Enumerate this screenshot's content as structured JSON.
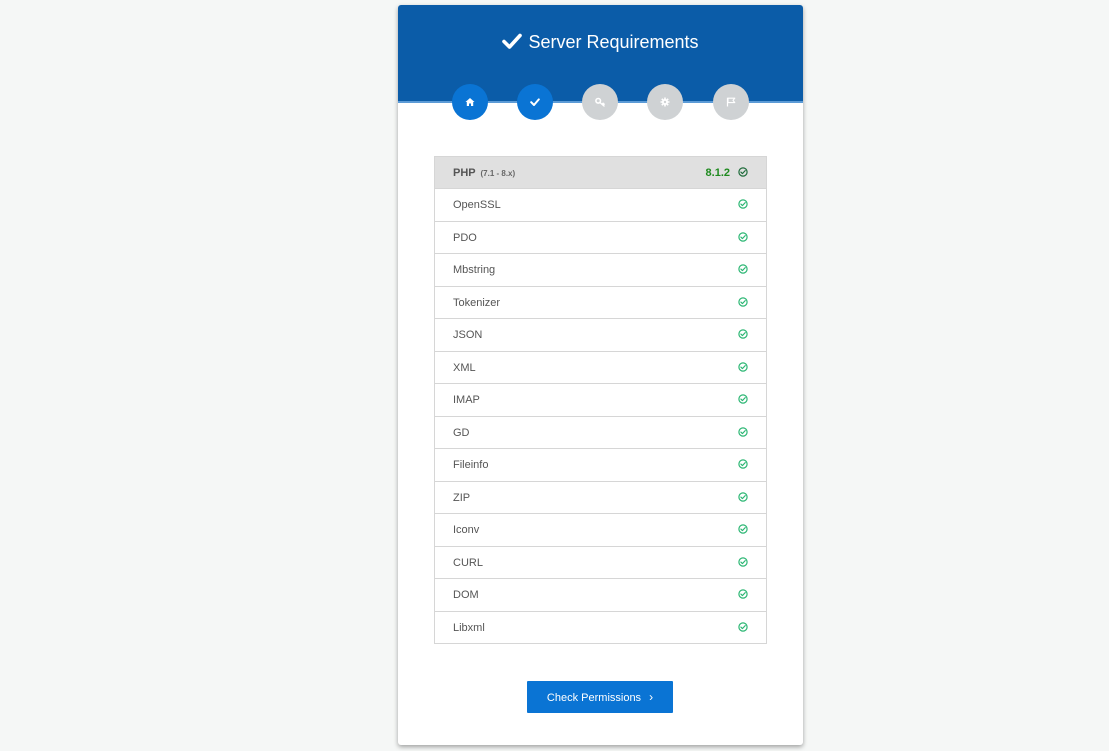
{
  "header": {
    "title": "Server Requirements",
    "icon": "check-icon"
  },
  "steps": [
    {
      "icon": "home-icon",
      "active": true
    },
    {
      "icon": "check-icon",
      "active": true
    },
    {
      "icon": "key-icon",
      "active": false
    },
    {
      "icon": "gear-icon",
      "active": false
    },
    {
      "icon": "flag-icon",
      "active": false
    }
  ],
  "php": {
    "label": "PHP",
    "range": "(7.1 - 8.x)",
    "version": "8.1.2"
  },
  "requirements": [
    {
      "name": "OpenSSL"
    },
    {
      "name": "PDO"
    },
    {
      "name": "Mbstring"
    },
    {
      "name": "Tokenizer"
    },
    {
      "name": "JSON"
    },
    {
      "name": "XML"
    },
    {
      "name": "IMAP"
    },
    {
      "name": "GD"
    },
    {
      "name": "Fileinfo"
    },
    {
      "name": "ZIP"
    },
    {
      "name": "Iconv"
    },
    {
      "name": "CURL"
    },
    {
      "name": "DOM"
    },
    {
      "name": "Libxml"
    }
  ],
  "button": {
    "label": "Check Permissions",
    "chevron": "›"
  },
  "colors": {
    "header_bg": "#0b5ca8",
    "step_active": "#0a74d4",
    "step_inactive": "#cfd2d4",
    "ok_green": "#2bb673",
    "version_green": "#1e8a1e",
    "button_bg": "#0a74d4"
  }
}
